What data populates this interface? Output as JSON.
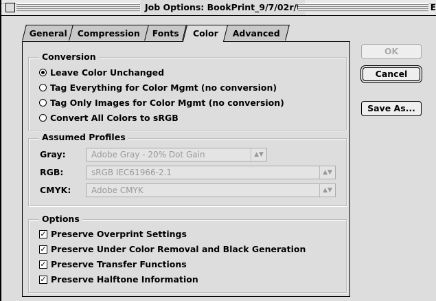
{
  "window": {
    "title": "Job Options: BookPrint_9/7/02r/t",
    "right_glyph": "E"
  },
  "tabs": [
    {
      "label": "General",
      "active": false
    },
    {
      "label": "Compression",
      "active": false
    },
    {
      "label": "Fonts",
      "active": false
    },
    {
      "label": "Color",
      "active": true
    },
    {
      "label": "Advanced",
      "active": false
    }
  ],
  "buttons": {
    "ok": "OK",
    "cancel": "Cancel",
    "save_as": "Save As..."
  },
  "conversion": {
    "title": "Conversion",
    "options": [
      {
        "label": "Leave Color Unchanged",
        "selected": true
      },
      {
        "label": "Tag Everything for Color Mgmt (no conversion)",
        "selected": false
      },
      {
        "label": "Tag Only Images for Color Mgmt (no conversion)",
        "selected": false
      },
      {
        "label": "Convert All Colors to sRGB",
        "selected": false
      }
    ]
  },
  "profiles": {
    "title": "Assumed Profiles",
    "gray": {
      "label": "Gray:",
      "value": "Adobe Gray - 20% Dot Gain"
    },
    "rgb": {
      "label": "RGB:",
      "value": "sRGB IEC61966-2.1"
    },
    "cmyk": {
      "label": "CMYK:",
      "value": "Adobe CMYK"
    }
  },
  "options": {
    "title": "Options",
    "items": [
      {
        "label": "Preserve Overprint Settings",
        "checked": true
      },
      {
        "label": "Preserve Under Color Removal and Black Generation",
        "checked": true
      },
      {
        "label": "Preserve Transfer Functions",
        "checked": true
      },
      {
        "label": "Preserve Halftone Information",
        "checked": true
      }
    ]
  }
}
